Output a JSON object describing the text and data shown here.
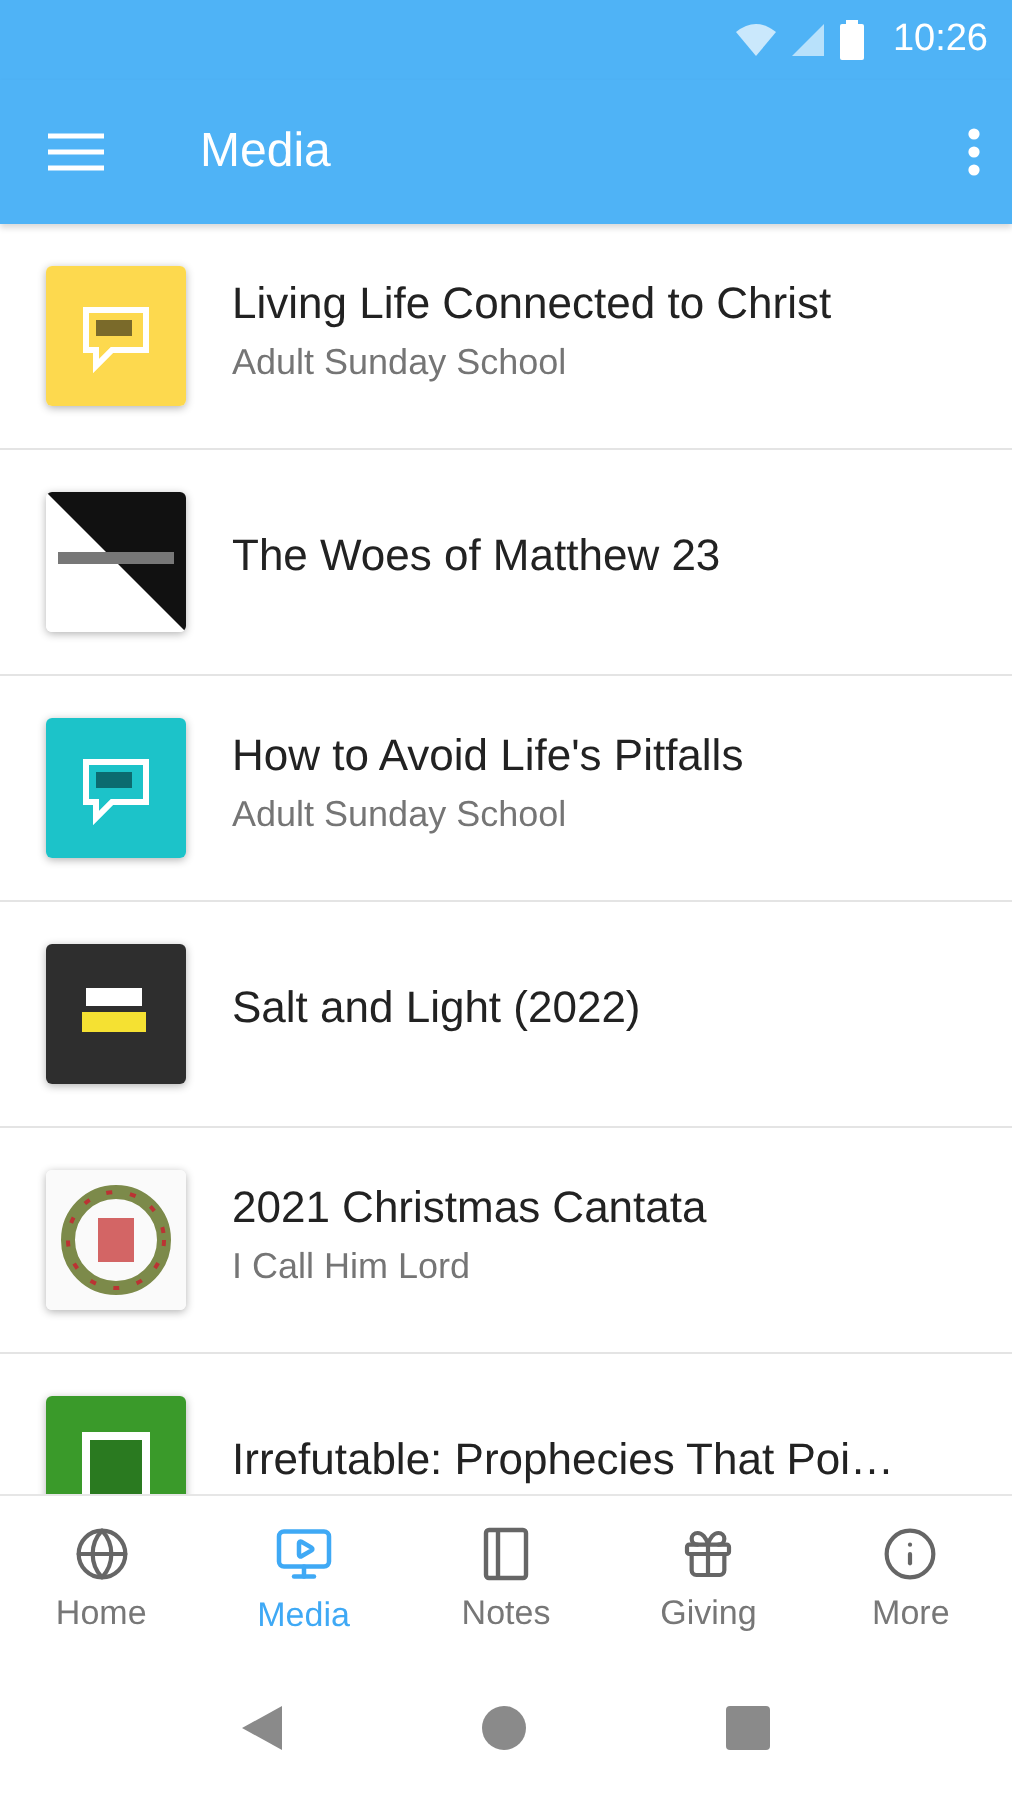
{
  "status_bar": {
    "time": "10:26"
  },
  "app_bar": {
    "title": "Media"
  },
  "media_items": [
    {
      "title": "Living Life Connected to Christ",
      "subtitle": "Adult Sunday School",
      "kind": "picture"
    },
    {
      "title": "The Woes of Matthew 23",
      "kind": "picture"
    },
    {
      "title": "How to Avoid Life's Pitfalls",
      "subtitle": "Adult Sunday School",
      "kind": "picture"
    },
    {
      "title": "Salt and Light (2022)",
      "kind": "picture"
    },
    {
      "title": "2021 Christmas Cantata",
      "subtitle": "I Call Him Lord",
      "kind": "picture"
    },
    {
      "title": "Irrefutable: Prophecies That Poi…",
      "kind": "picture"
    }
  ],
  "bottom_nav": [
    {
      "label": "Home",
      "selected": false
    },
    {
      "label": "Media",
      "selected": true
    },
    {
      "label": "Notes",
      "selected": false
    },
    {
      "label": "Giving",
      "selected": false
    },
    {
      "label": "More",
      "selected": false
    }
  ]
}
